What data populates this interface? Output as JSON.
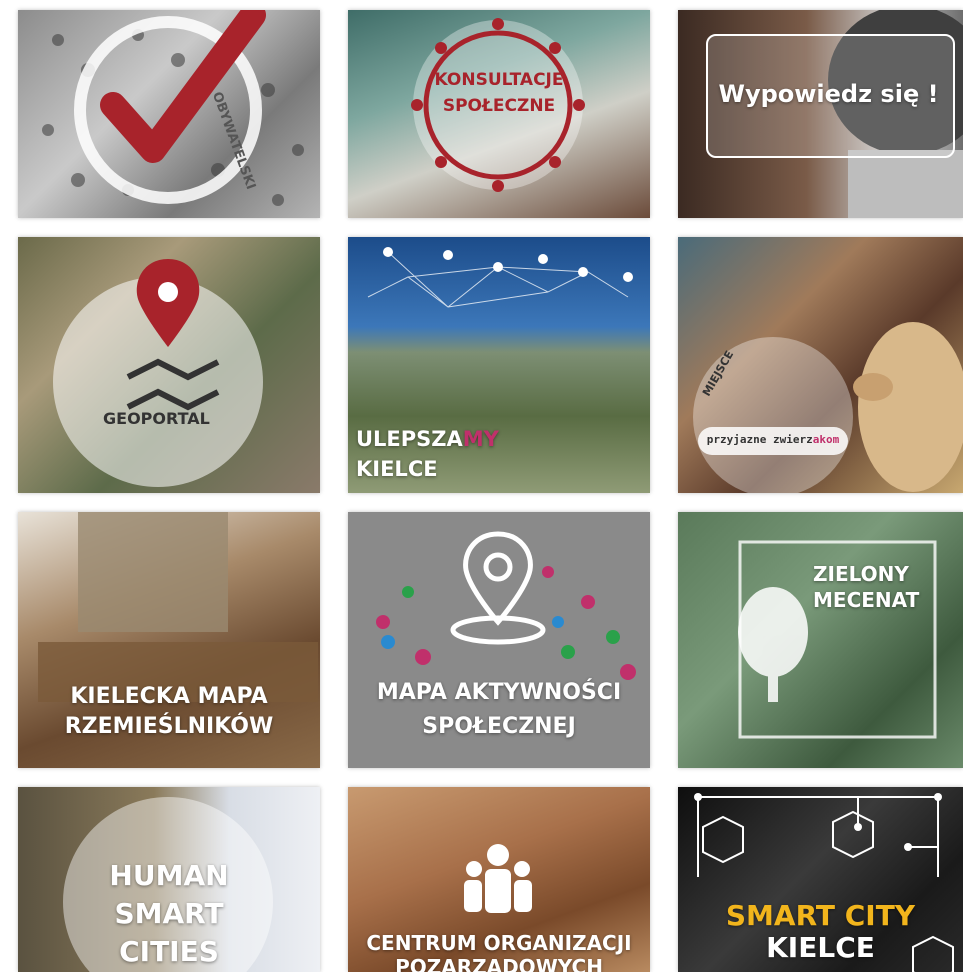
{
  "tiles": {
    "obywatelski": {
      "label": "OBYWATELSKI"
    },
    "konsultacje": {
      "line1": "KONSULTACJE",
      "line2": "SPOŁECZNE"
    },
    "wypowiedz": {
      "label": "Wypowiedz się !"
    },
    "geoportal": {
      "label": "GEO",
      "label2": "POR",
      "label3": "TAL"
    },
    "ulepszamy": {
      "part1": "ULEPSZA",
      "part2": "MY",
      "line2": "KIELCE"
    },
    "miejsce": {
      "badge_top": "MIEJSCE",
      "badge_text": "przyjazne zwierz",
      "badge_accent": "akom"
    },
    "rzemieslnicy": {
      "line1": "KIELECKA MAPA",
      "line2": "RZEMIEŚLNIKÓW"
    },
    "aktywnosc": {
      "line1": "MAPA AKTYWNOŚCI",
      "line2": "SPOŁECZNEJ"
    },
    "zielony": {
      "line1": "ZIELONY",
      "line2": "MECENAT"
    },
    "human": {
      "line1": "HUMAN",
      "line2": "SMART",
      "line3": "CITIES"
    },
    "centrum": {
      "line1": "CENTRUM ORGANIZACJI",
      "line2": "POZARZĄDOWYCH"
    },
    "smartcity": {
      "line1": "SMART CITY",
      "line2": "KIELCE"
    }
  },
  "colors": {
    "red": "#a8232b",
    "magenta": "#c0306b",
    "yellow": "#f2b51c",
    "green": "#4d6b4c",
    "grey": "#8a8a8a"
  }
}
